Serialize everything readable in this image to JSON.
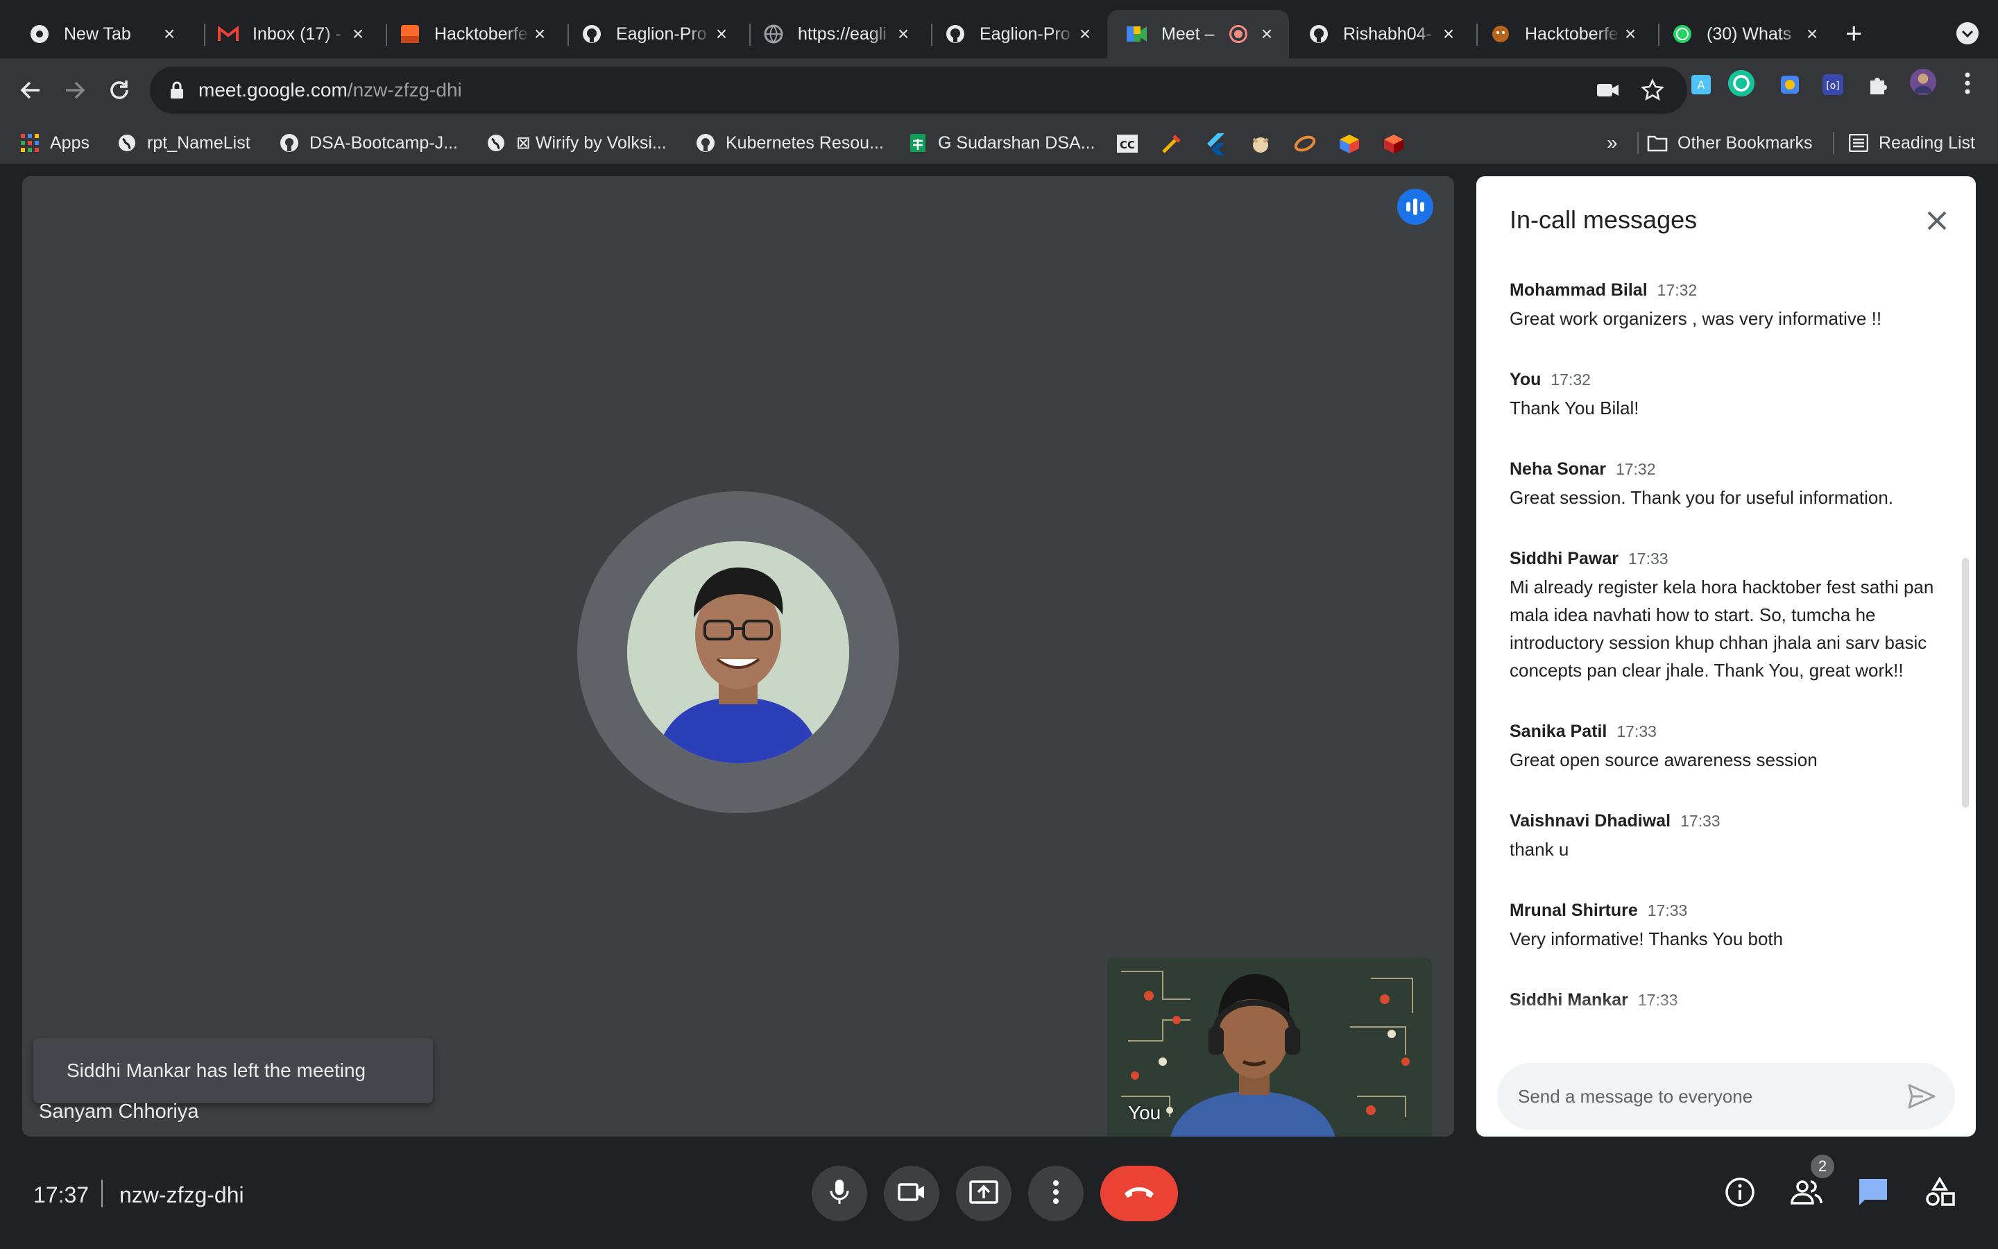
{
  "browser": {
    "tabs": [
      {
        "title": "New Tab",
        "icon": "chrome-icon"
      },
      {
        "title": "Inbox (17) -",
        "icon": "gmail-icon"
      },
      {
        "title": "Hacktoberfe",
        "icon": "hacktoberfest-icon"
      },
      {
        "title": "Eaglion-Pro",
        "icon": "github-icon"
      },
      {
        "title": "https://eagli",
        "icon": "globe-icon"
      },
      {
        "title": "Eaglion-Pro",
        "icon": "github-icon"
      },
      {
        "title": "Meet – ",
        "icon": "meet-icon"
      },
      {
        "title": "Rishabh04-",
        "icon": "github-icon"
      },
      {
        "title": "Hacktoberfe",
        "icon": "hacktoberfest-icon"
      },
      {
        "title": "(30) Whats",
        "icon": "whatsapp-icon"
      }
    ],
    "active_tab": 6,
    "url_host": "meet.google.com",
    "url_path": "/nzw-zfzg-dhi",
    "bookmarks": [
      {
        "label": "Apps",
        "icon": "apps-grid-icon"
      },
      {
        "label": "rpt_NameList",
        "icon": "globe-icon"
      },
      {
        "label": "DSA-Bootcamp-J...",
        "icon": "github-icon"
      },
      {
        "label": "⊠ Wirify by Volksi...",
        "icon": "globe-icon"
      },
      {
        "label": "Kubernetes Resou...",
        "icon": "github-icon"
      },
      {
        "label": "G Sudarshan DSA...",
        "icon": "sheets-icon"
      }
    ],
    "bookmarks_overflow": "»",
    "other_bookmarks": "Other Bookmarks",
    "reading_list": "Reading List"
  },
  "meet": {
    "main_participant_name": "Sanyam Chhoriya",
    "toast": "Siddhi Mankar has left the meeting",
    "self_label": "You",
    "chat": {
      "title": "In-call messages",
      "messages": [
        {
          "sender": "Mohammad Bilal",
          "time": "17:32",
          "text": "Great work organizers , was very informative !!"
        },
        {
          "sender": "You",
          "time": "17:32",
          "text": "Thank You Bilal!"
        },
        {
          "sender": "Neha Sonar",
          "time": "17:32",
          "text": "Great session. Thank you for useful information."
        },
        {
          "sender": "Siddhi Pawar",
          "time": "17:33",
          "text": "Mi already register kela hora hacktober fest sathi pan mala idea navhati how to start. So, tumcha he introductory session khup chhan jhala ani sarv basic concepts pan clear jhale. Thank You, great work!!"
        },
        {
          "sender": "Sanika Patil",
          "time": "17:33",
          "text": "Great open source awareness session"
        },
        {
          "sender": "Vaishnavi Dhadiwal",
          "time": "17:33",
          "text": "thank u"
        },
        {
          "sender": "Mrunal Shirture",
          "time": "17:33",
          "text": "Very informative! Thanks You both"
        },
        {
          "sender": "Siddhi Mankar",
          "time": "17:33",
          "text": ""
        }
      ],
      "input_placeholder": "Send a message to everyone"
    },
    "bottom": {
      "clock": "17:37",
      "meeting_code": "nzw-zfzg-dhi",
      "people_count": "2"
    }
  },
  "colors": {
    "leave": "#ea4335",
    "accent": "#1a73e8",
    "stage": "#3c4043"
  }
}
